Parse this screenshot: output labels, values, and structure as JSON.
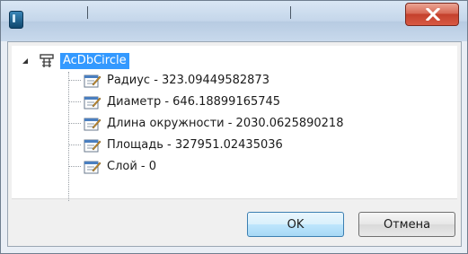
{
  "dialog": {
    "title": "",
    "close_symbol": "x"
  },
  "tree": {
    "root": {
      "label": "AcDbCircle",
      "icon": "class-icon",
      "expanded": true
    },
    "items": [
      {
        "label": "Радиус - 323.09449582873",
        "icon": "property-icon"
      },
      {
        "label": "Диаметр - 646.18899165745",
        "icon": "property-icon"
      },
      {
        "label": "Длина окружности - 2030.0625890218",
        "icon": "property-icon"
      },
      {
        "label": "Площадь - 327951.02435036",
        "icon": "property-icon"
      },
      {
        "label": "Слой - 0",
        "icon": "property-icon"
      }
    ]
  },
  "buttons": {
    "ok": "OK",
    "cancel": "Отмена"
  },
  "colors": {
    "selection": "#3399ff",
    "close_button": "#c4402c"
  }
}
